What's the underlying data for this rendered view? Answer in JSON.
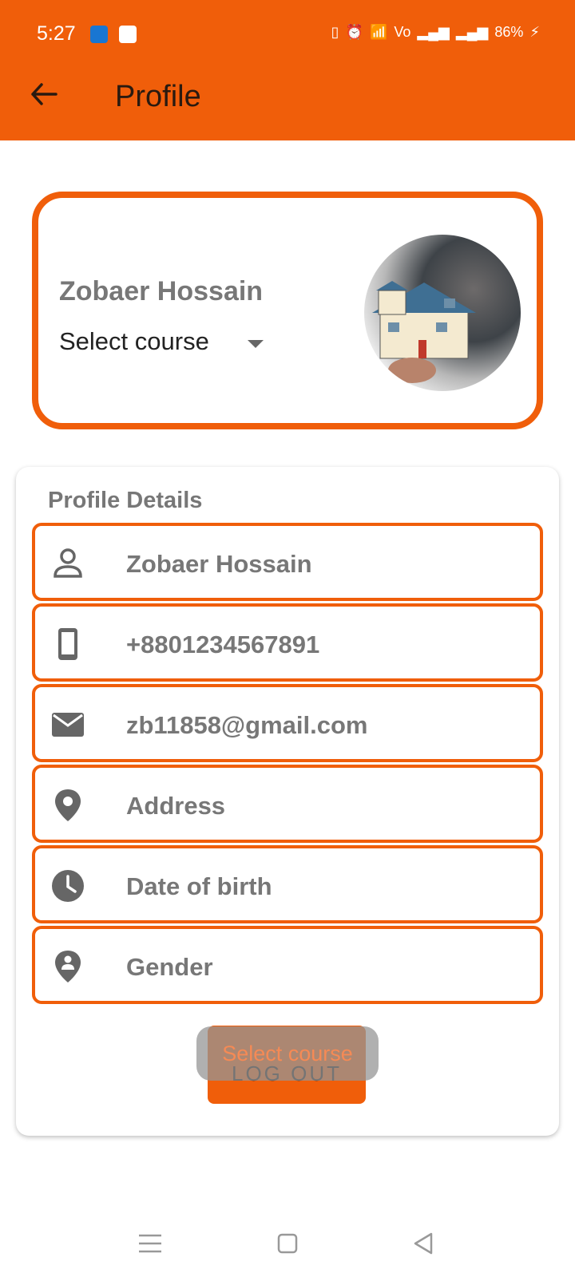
{
  "status_bar": {
    "time": "5:27",
    "battery": "86%",
    "icons": [
      "usb-icon",
      "linkedin-icon",
      "vibrate-icon",
      "alarm-icon",
      "wifi-icon",
      "volte-icon",
      "signal-icon",
      "signal-icon",
      "charging-icon"
    ]
  },
  "app_bar": {
    "title": "Profile",
    "back_icon": "arrow-back-icon"
  },
  "profile_card": {
    "name": "Zobaer Hossain",
    "course_select": "Select course",
    "avatar_icon": "avatar-photo"
  },
  "details": {
    "title": "Profile Details",
    "fields": [
      {
        "icon": "person-icon",
        "value": "Zobaer Hossain"
      },
      {
        "icon": "phone-icon",
        "value": "+8801234567891"
      },
      {
        "icon": "email-icon",
        "value": "zb11858@gmail.com"
      },
      {
        "icon": "location-pin-icon",
        "value": "Address"
      },
      {
        "icon": "clock-icon",
        "value": "Date of birth"
      },
      {
        "icon": "gender-icon",
        "value": "Gender"
      }
    ],
    "logout_label": "LOG OUT"
  },
  "toast": {
    "text": "Select course"
  },
  "colors": {
    "accent": "#F05E0A",
    "text_muted": "#777777"
  }
}
